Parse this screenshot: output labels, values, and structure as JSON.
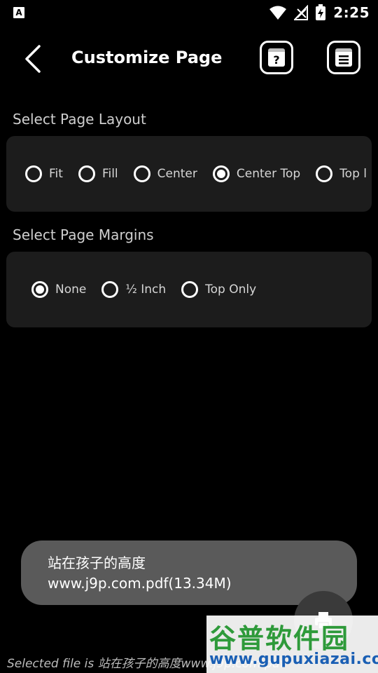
{
  "statusbar": {
    "left_icon": "A",
    "time": "2:25",
    "icons": [
      "wifi-icon",
      "no-signal-icon",
      "battery-charging-icon"
    ]
  },
  "appbar": {
    "title": "Customize Page",
    "icons": [
      "back-arrow-icon",
      "help-book-icon",
      "page-layout-icon"
    ]
  },
  "layout_section": {
    "label": "Select Page Layout",
    "options": [
      "Fit",
      "Fill",
      "Center",
      "Center Top",
      "Top l"
    ],
    "selected": "Center Top"
  },
  "margins_section": {
    "label": "Select Page Margins",
    "options": [
      "None",
      "½ Inch",
      "Top Only"
    ],
    "selected": "None"
  },
  "toast": {
    "line1": "站在孩子的高度",
    "line2": "www.j9p.com.pdf(13.34M)"
  },
  "footer": {
    "text": "Selected file is 站在孩子的高度www.j9p.com.pdf"
  },
  "watermark": {
    "title": "谷普软件园",
    "url": "www.gupuxiazai.com"
  },
  "colors": {
    "background": "#000000",
    "card": "#1c1c1c",
    "toast": "#5a5a5a",
    "watermark_green": "#2e9a3a",
    "watermark_blue": "#1a5fb4"
  }
}
